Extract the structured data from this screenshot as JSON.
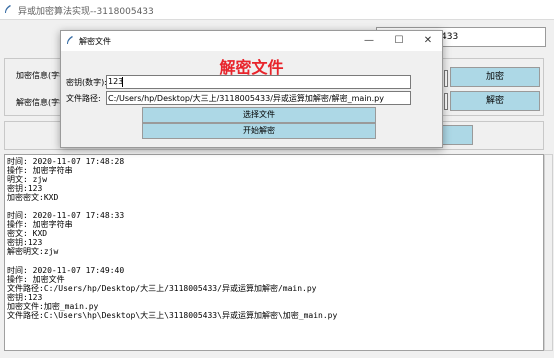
{
  "main_window": {
    "title": "异或加密算法实现--3118005433",
    "partial_id_text": "433",
    "encrypt_info_label": "加密信息(字符",
    "decrypt_info_label": "解密信息(字符",
    "encrypt_button": "加密",
    "decrypt_button": "解密",
    "encrypt_input_value": "",
    "decrypt_input_value": ""
  },
  "dialog": {
    "title": "解密文件",
    "heading": "解密文件",
    "key_label": "密钥(数字):",
    "key_value": "123",
    "path_label": "文件路径:",
    "path_value": "C:/Users/hp/Desktop/大三上/3118005433/异或运算加解密/解密_main.py",
    "select_file_button": "选择文件",
    "start_decrypt_button": "开始解密",
    "minimize_glyph": "—",
    "maximize_glyph": "☐",
    "close_glyph": "✕"
  },
  "log": {
    "lines": [
      "时间: 2020-11-07 17:48:28",
      "操作: 加密字符串",
      "明文: zjw",
      "密钥:123",
      "加密密文:KXD",
      "",
      "时间: 2020-11-07 17:48:33",
      "操作: 加密字符串",
      "密文: KXD",
      "密钥:123",
      "解密明文:zjw",
      "",
      "时间: 2020-11-07 17:49:40",
      "操作: 加密文件",
      "文件路径:C:/Users/hp/Desktop/大三上/3118005433/异或运算加解密/main.py",
      "密钥:123",
      "加密文件:加密_main.py",
      "文件路径:C:\\Users\\hp\\Desktop\\大三上\\3118005433\\异或运算加解密\\加密_main.py"
    ]
  },
  "icons": {
    "app_icon": "feather-icon"
  }
}
